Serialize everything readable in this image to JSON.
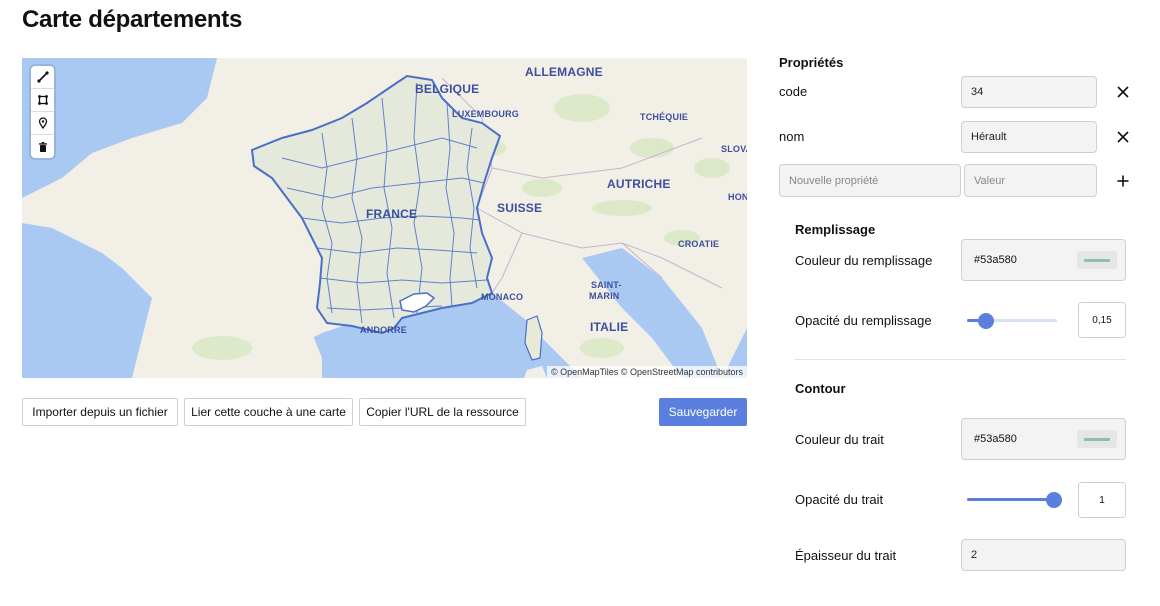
{
  "page": {
    "title": "Carte départements"
  },
  "map": {
    "labels": {
      "allemagne": "ALLEMAGNE",
      "belgique": "BELGIQUE",
      "luxembourg": "LUXEMBOURG",
      "tchequie": "TCHÉQUIE",
      "slova": "SLOVA",
      "autriche": "AUTRICHE",
      "hon": "HON",
      "suisse": "SUISSE",
      "france": "FRANCE",
      "croatie": "CROATIE",
      "saint": "SAINT-",
      "marin": "MARIN",
      "monaco": "MONACO",
      "italie": "ITALIE",
      "andorre": "ANDORRE"
    },
    "attribution": "© OpenMapTiles © OpenStreetMap contributors",
    "tools": [
      "line-icon",
      "polygon-icon",
      "marker-icon",
      "trash-icon"
    ],
    "colors": {
      "sea": "#a9c9f3",
      "land": "#f2efe6",
      "forest": "#d6e8c3",
      "department_stroke": "#53a580",
      "outline": "#4a6fc9"
    }
  },
  "actions": {
    "import": "Importer depuis un fichier",
    "link": "Lier cette couche à une carte",
    "copy": "Copier l'URL de la ressource",
    "save": "Sauvegarder"
  },
  "properties": {
    "title": "Propriétés",
    "rows": [
      {
        "key": "code",
        "value": "34"
      },
      {
        "key": "nom",
        "value": "Hérault"
      }
    ],
    "new_key_placeholder": "Nouvelle propriété",
    "new_value_placeholder": "Valeur"
  },
  "fill": {
    "title": "Remplissage",
    "color_label": "Couleur du remplissage",
    "color_value": "#53a580",
    "opacity_label": "Opacité du remplissage",
    "opacity_value": "0,15",
    "opacity_fraction": 0.15
  },
  "stroke": {
    "title": "Contour",
    "color_label": "Couleur du trait",
    "color_value": "#53a580",
    "opacity_label": "Opacité du trait",
    "opacity_value": "1",
    "opacity_fraction": 1,
    "width_label": "Épaisseur du trait",
    "width_value": "2"
  },
  "accent": "#5a7fdf"
}
